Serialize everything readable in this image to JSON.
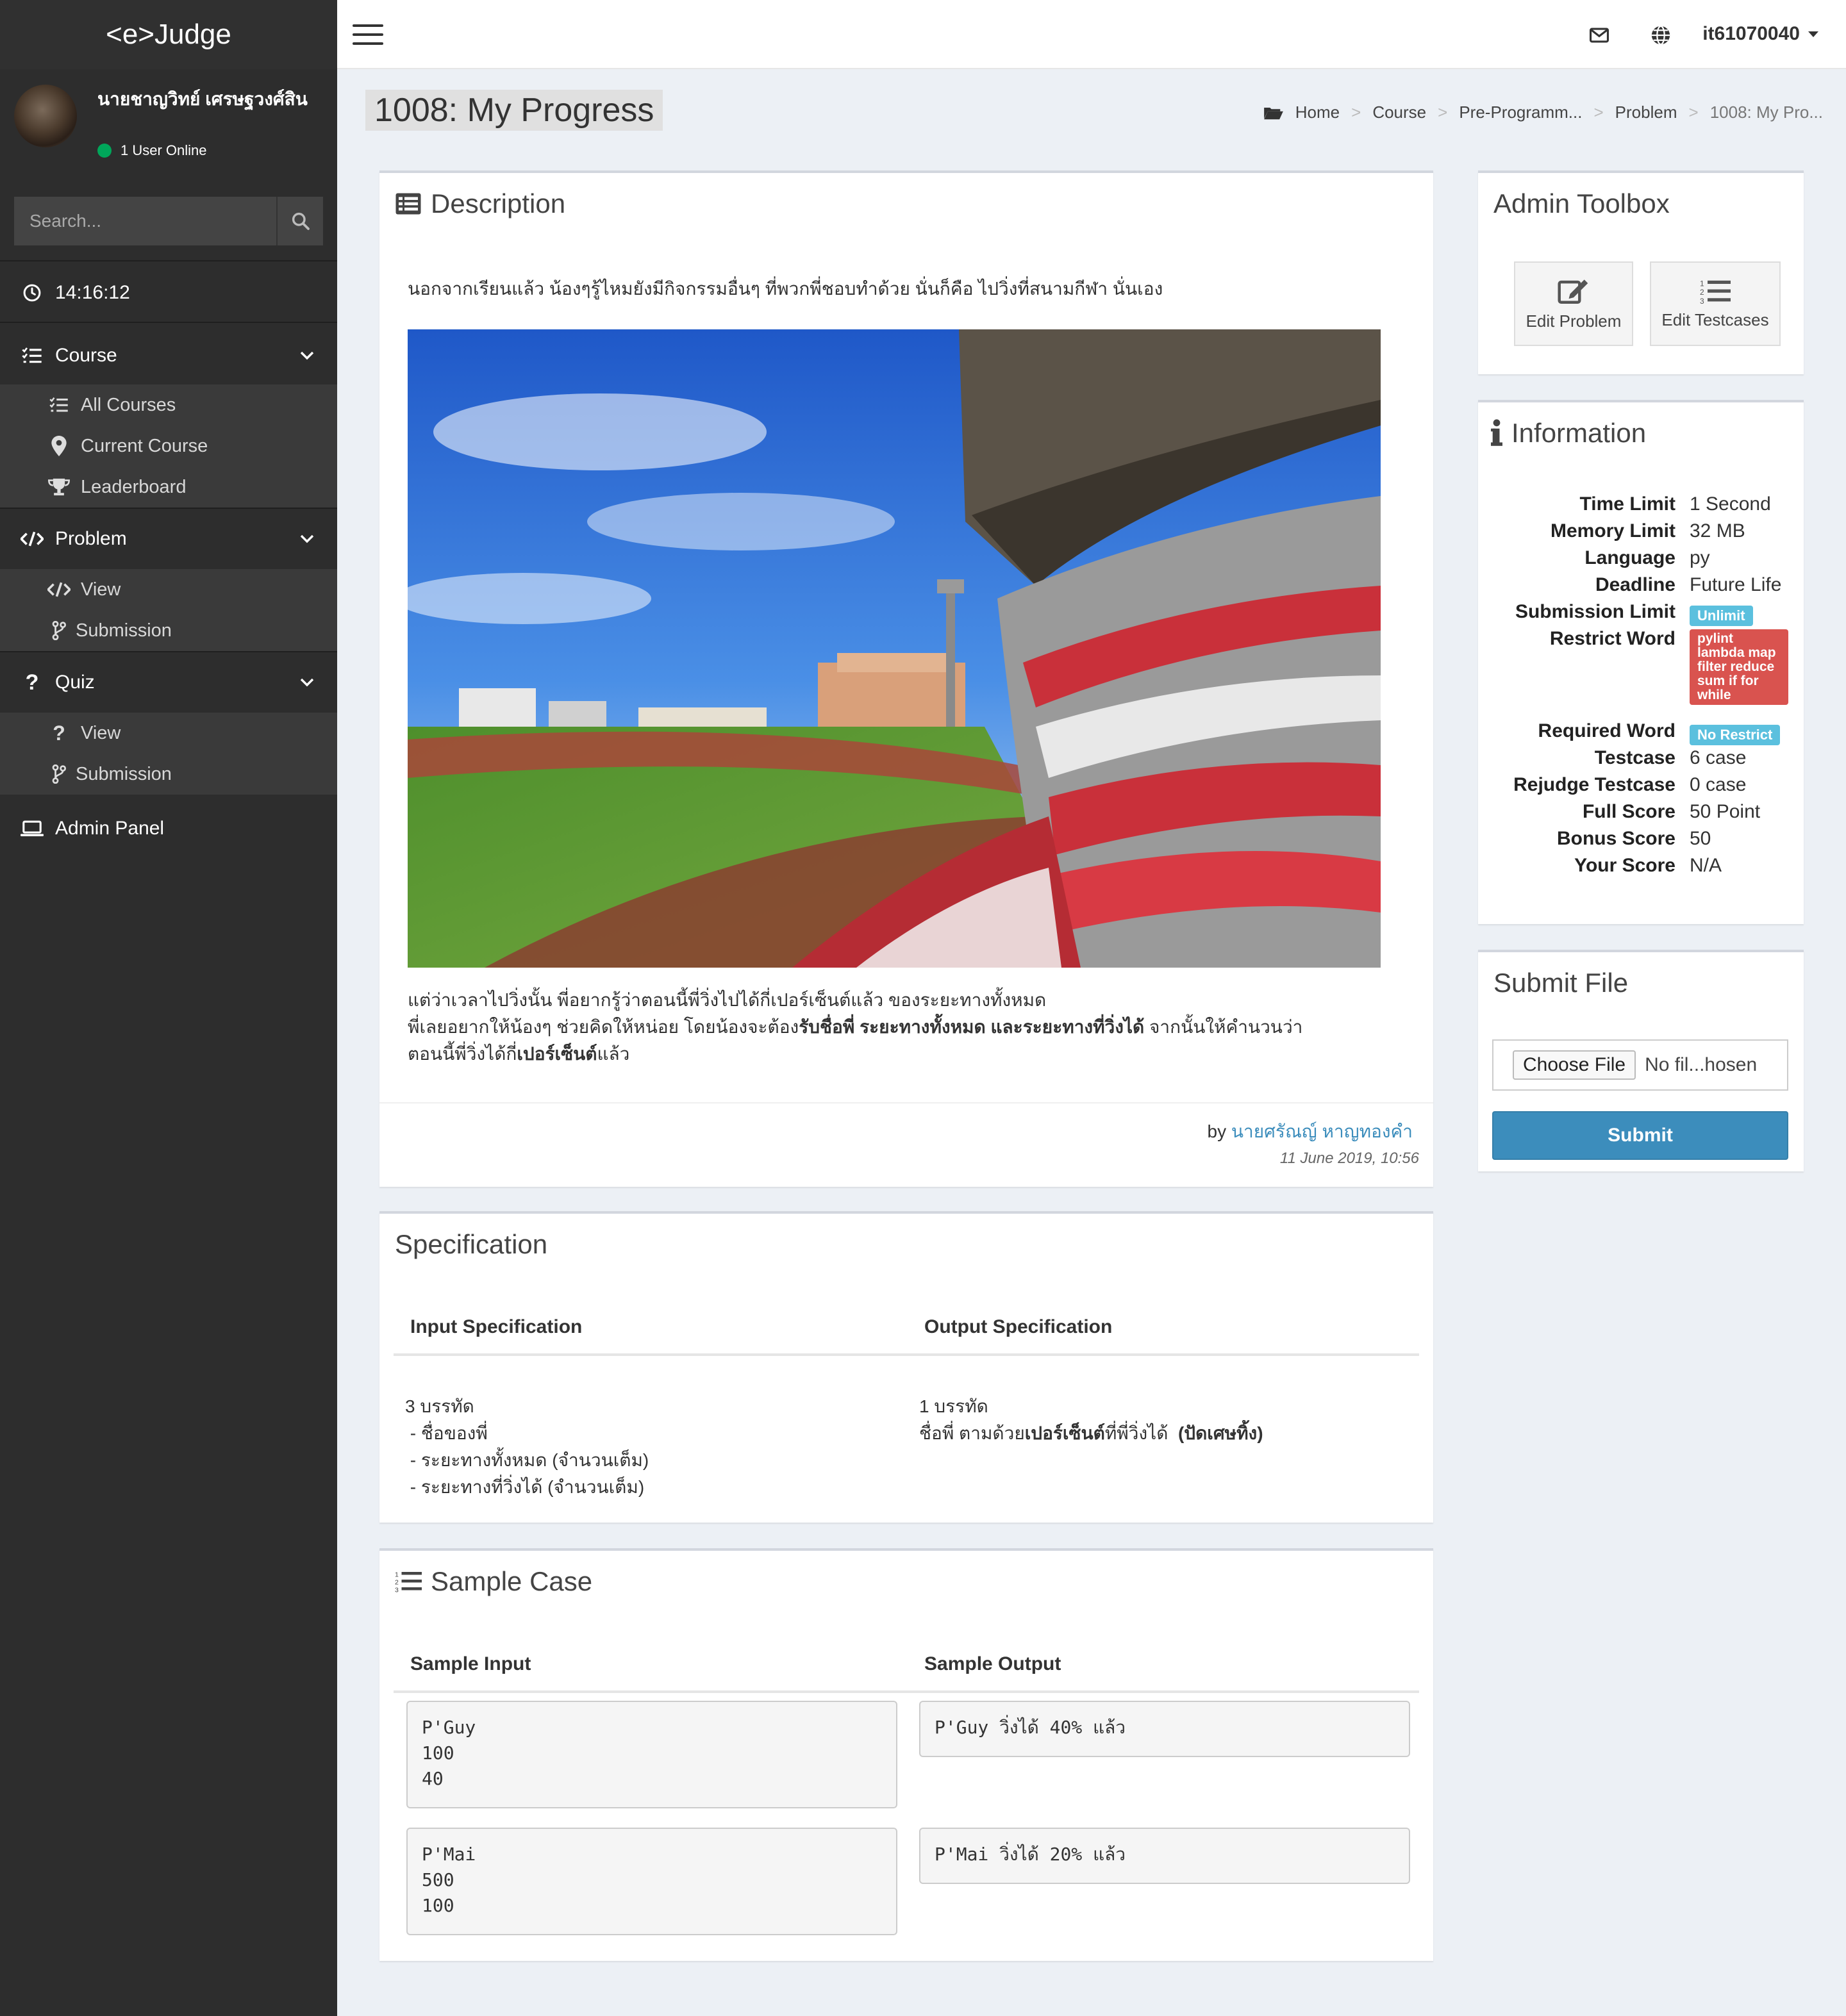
{
  "app": {
    "logo": "<e>Judge"
  },
  "user": {
    "name": "นายชาญวิทย์ เศรษฐวงศ์สิน",
    "online_text": "1 User Online",
    "username": "it61070040"
  },
  "search": {
    "placeholder": "Search..."
  },
  "sidebar": {
    "clock": "14:16:12",
    "course": {
      "label": "Course",
      "items": [
        "All Courses",
        "Current Course",
        "Leaderboard"
      ]
    },
    "problem": {
      "label": "Problem",
      "items": [
        "View",
        "Submission"
      ]
    },
    "quiz": {
      "label": "Quiz",
      "items": [
        "View",
        "Submission"
      ]
    },
    "admin": "Admin Panel"
  },
  "header": {
    "title": "1008: My Progress",
    "breadcrumb": [
      "Home",
      "Course",
      "Pre-Programm...",
      "Problem",
      "1008: My Pro..."
    ]
  },
  "description": {
    "title": "Description",
    "intro": "นอกจากเรียนแล้ว น้องๆรู้ไหมยังมีกิจกรรมอื่นๆ ที่พวกพี่ชอบทำด้วย นั่นก็คือ ไปวิ่งที่สนามกีฬา นั่นเอง",
    "line1": "แต่ว่าเวลาไปวิ่งนั้น พี่อยากรู้ว่าตอนนี้พี่วิ่งไปได้กี่เปอร์เซ็นต์แล้ว ของระยะทางทั้งหมด",
    "line2_a": "พี่เลยอยากให้น้องๆ ช่วยคิดให้หน่อย โดยน้องจะต้อง",
    "line2_b": "รับชื่อพี่ ระยะทางทั้งหมด และระยะทางที่วิ่งได้",
    "line2_c": " จากนั้นให้คำนวนว่า",
    "line3_a": "ตอนนี้พี่วิ่งได้กี่",
    "line3_b": "เปอร์เซ็นต์",
    "line3_c": "แล้ว",
    "by": "by",
    "author": "นายศรัณญ์ หาญทองคำ",
    "date": "11 June 2019, 10:56"
  },
  "specification": {
    "title": "Specification",
    "input_header": "Input Specification",
    "output_header": "Output Specification",
    "input_text": "3 บรรทัด\n - ชื่อของพี่\n - ระยะทางทั้งหมด (จำนวนเต็ม)\n - ระยะทางที่วิ่งได้ (จำนวนเต็ม)",
    "output_line1": "1 บรรทัด",
    "output_a": "ชื่อพี่ ตามด้วย",
    "output_b": "เปอร์เซ็นต์",
    "output_c": "ที่พี่วิ่งได้  ",
    "output_d": "(ปัดเศษทิ้ง)"
  },
  "sample": {
    "title": "Sample Case",
    "input_header": "Sample Input",
    "output_header": "Sample Output",
    "cases": [
      {
        "input": "P'Guy\n100\n40",
        "output": "P'Guy วิ่งได้ 40% แล้ว"
      },
      {
        "input": "P'Mai\n500\n100",
        "output": "P'Mai วิ่งได้ 20% แล้ว"
      }
    ]
  },
  "toolbox": {
    "title": "Admin Toolbox",
    "edit_problem": "Edit Problem",
    "edit_testcases": "Edit Testcases"
  },
  "information": {
    "title": "Information",
    "rows": [
      {
        "k": "Time Limit",
        "v": "1 Second"
      },
      {
        "k": "Memory Limit",
        "v": "32 MB"
      },
      {
        "k": "Language",
        "v": "py"
      },
      {
        "k": "Deadline",
        "v": "Future Life"
      },
      {
        "k": "Submission Limit",
        "v": "Unlimit"
      },
      {
        "k": "Restrict Word",
        "v": "pylint lambda map filter reduce sum if for while"
      },
      {
        "k": "Required Word",
        "v": "No Restrict"
      },
      {
        "k": "Testcase",
        "v": "6 case"
      },
      {
        "k": "Rejudge Testcase",
        "v": "0 case"
      },
      {
        "k": "Full Score",
        "v": "50 Point"
      },
      {
        "k": "Bonus Score",
        "v": "50"
      },
      {
        "k": "Your Score",
        "v": "N/A"
      }
    ]
  },
  "submit": {
    "title": "Submit File",
    "choose": "Choose File",
    "nofile": "No fil...hosen",
    "button": "Submit"
  },
  "colors": {
    "accent": "#3c8dbc",
    "sidebar": "#2d2d2d",
    "badge_info": "#5bc0de",
    "badge_danger": "#d9534f",
    "online": "#00a65a"
  }
}
